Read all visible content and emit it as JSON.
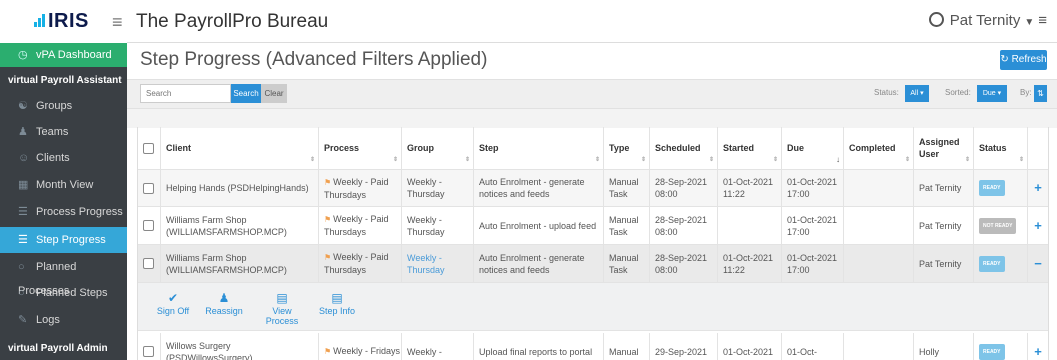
{
  "header": {
    "logo_text": "IRIS",
    "bureau_name": "The PayrollPro Bureau",
    "user_name": "Pat Ternity"
  },
  "sidebar": {
    "dashboard": "vPA Dashboard",
    "section_vpa": "virtual Payroll Assistant",
    "items": [
      {
        "label": "Groups",
        "icon": "groups-icon"
      },
      {
        "label": "Teams",
        "icon": "teams-icon"
      },
      {
        "label": "Clients",
        "icon": "clients-icon"
      },
      {
        "label": "Month View",
        "icon": "calendar-icon"
      },
      {
        "label": "Process Progress",
        "icon": "bars-icon"
      },
      {
        "label": "Step Progress",
        "icon": "list-icon"
      },
      {
        "label": "Planned Processes",
        "icon": "circle-icon"
      },
      {
        "label": "Planned Steps",
        "icon": "circle-icon"
      },
      {
        "label": "Logs",
        "icon": "logs-icon"
      }
    ],
    "section_admin": "virtual Payroll Admin"
  },
  "main": {
    "title": "Step Progress (Advanced Filters Applied)",
    "refresh_label": "Refresh",
    "search_placeholder": "Search",
    "search_button": "Search",
    "clear_button": "Clear",
    "status_label": "Status:",
    "status_value": "All",
    "sorted_label": "Sorted:",
    "sorted_value": "Due",
    "by_label": "By:"
  },
  "table": {
    "columns": [
      "Client",
      "Process",
      "Group",
      "Step",
      "Type",
      "Scheduled",
      "Started",
      "Due",
      "Completed",
      "Assigned User",
      "Status"
    ],
    "rows": [
      {
        "client": "Helping Hands (PSDHelpingHands)",
        "process": "Weekly - Paid Thursdays",
        "group": "Weekly - Thursday",
        "step": "Auto Enrolment - generate notices and feeds",
        "type": "Manual Task",
        "scheduled": "28-Sep-2021 08:00",
        "started": "01-Oct-2021 11:22",
        "due": "01-Oct-2021 17:00",
        "completed": "",
        "user": "Pat Ternity",
        "status": "READY",
        "expand": "+"
      },
      {
        "client": "Williams Farm Shop (WILLIAMSFARMSHOP.MCP)",
        "process": "Weekly - Paid Thursdays",
        "group": "Weekly - Thursday",
        "step": "Auto Enrolment - upload feed",
        "type": "Manual Task",
        "scheduled": "28-Sep-2021 08:00",
        "started": "",
        "due": "01-Oct-2021 17:00",
        "completed": "",
        "user": "Pat Ternity",
        "status": "NOT READY",
        "expand": "+"
      },
      {
        "client": "Williams Farm Shop (WILLIAMSFARMSHOP.MCP)",
        "process": "Weekly - Paid Thursdays",
        "group": "Weekly - Thursday",
        "step": "Auto Enrolment - generate notices and feeds",
        "type": "Manual Task",
        "scheduled": "28-Sep-2021 08:00",
        "started": "01-Oct-2021 11:22",
        "due": "01-Oct-2021 17:00",
        "completed": "",
        "user": "Pat Ternity",
        "status": "READY",
        "expand": "−"
      },
      {
        "client": "Willows Surgery (PSDWillowsSurgery)",
        "process": "Weekly - Fridays",
        "group": "Weekly -",
        "step": "Upload final reports to portal",
        "type": "Manual",
        "scheduled": "29-Sep-2021",
        "started": "01-Oct-2021",
        "due": "01-Oct-",
        "completed": "",
        "user": "Holly",
        "status": "READY",
        "expand": "+"
      }
    ]
  },
  "actions": [
    {
      "label": "Sign Off",
      "icon": "check-icon"
    },
    {
      "label": "Reassign",
      "icon": "reassign-icon"
    },
    {
      "label": "View Process",
      "icon": "window-icon"
    },
    {
      "label": "Step Info",
      "icon": "info-window-icon"
    }
  ],
  "colors": {
    "accent": "#2b8fd6",
    "sidebar": "#3a3f44",
    "active": "#35a7d8",
    "dashboard": "#2bae6f"
  }
}
